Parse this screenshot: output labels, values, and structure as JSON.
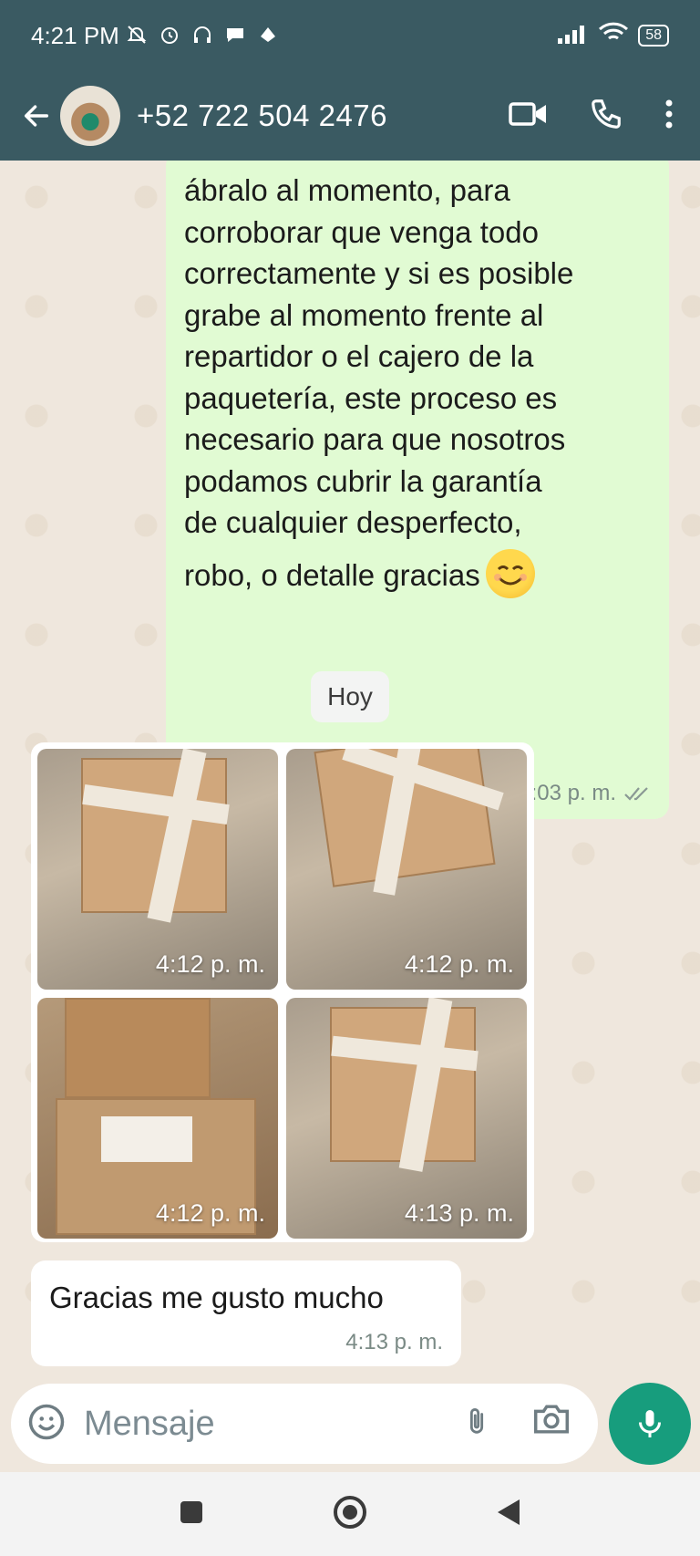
{
  "status": {
    "time": "4:21 PM",
    "battery": "58"
  },
  "header": {
    "contact": "+52 722 504 2476"
  },
  "chat": {
    "outgoing": {
      "lines": [
        "ábralo al momento, para",
        "corroborar que venga todo",
        "correctamente y si es posible",
        "grabe al momento frente al",
        "repartidor o el cajero de la",
        "paquetería, este proceso es",
        "necesario para que nosotros",
        "podamos cubrir la garantía",
        "de cualquier desperfecto,",
        "robo, o detalle gracias"
      ],
      "time": "6:03 p. m."
    },
    "date_chip": "Hoy",
    "album": {
      "photos": [
        {
          "time": "4:12 p. m."
        },
        {
          "time": "4:12 p. m."
        },
        {
          "time": "4:12 p. m."
        },
        {
          "time": "4:13 p. m."
        }
      ]
    },
    "incoming": {
      "text": "Gracias me gusto mucho",
      "time": "4:13 p. m."
    }
  },
  "composer": {
    "placeholder": "Mensaje"
  },
  "colors": {
    "header": "#3a5a62",
    "accent": "#179d7d",
    "outgoing_bubble": "#e1fbd3"
  }
}
